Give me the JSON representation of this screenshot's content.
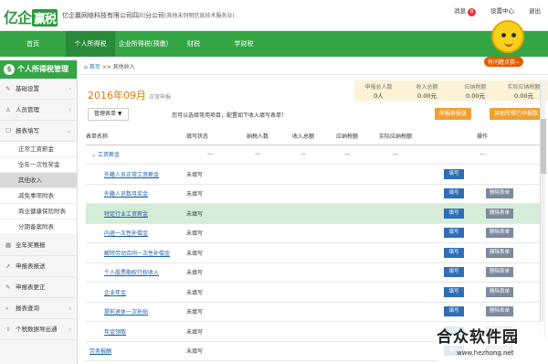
{
  "header": {
    "logo": "亿企",
    "logo_badge": "赢税",
    "company": "亿企赢网络科技有限公司四川分公司",
    "company_note": "(其他未列明信息技术服务业)",
    "message": "消息",
    "message_count": "8",
    "help": "设置中心",
    "link": "退出"
  },
  "nav": [
    "首页",
    "个人所得税",
    "企业所得税(预缴)",
    "财税",
    "学财税"
  ],
  "mascot_bubble": "有问题点我~",
  "sidebar": {
    "title": "个人所得税管理",
    "items": [
      "基础设置",
      "人员管理",
      "报表填写"
    ],
    "sub": [
      "正常工资薪金",
      "全年一次性奖金",
      "其他收入",
      "减免事项附表",
      "商业健康保险附表",
      "分期备案附表"
    ],
    "items2": [
      "全年奖赛报",
      "申报表报送",
      "申报表更正",
      "报表查询",
      "个税数据导出通"
    ]
  },
  "crumb": {
    "home": "首页",
    "sep": ">>",
    "current": "其他收入"
  },
  "period": {
    "text": "2016年09月",
    "note": "正常申报"
  },
  "stats": [
    {
      "k": "申报总人数",
      "v": "0人"
    },
    {
      "k": "收入总额",
      "v": "0.00元"
    },
    {
      "k": "应纳税额",
      "v": "0.00元"
    },
    {
      "k": "实际应纳税额",
      "v": "0.00元"
    }
  ],
  "toolbar": {
    "manage": "管理表单 ▼",
    "tip": "您可以选择常用项目，配置如下收入填写表单！",
    "btn1": "申报表报送",
    "btn2": "其他所得已申报数"
  },
  "table": {
    "headers": [
      "表单名称",
      "填写状态",
      "纳税人数",
      "收入总额",
      "应纳税额",
      "实际应纳税额",
      "操作"
    ],
    "group": "工资薪金",
    "rows": [
      {
        "name": "外籍人员正常工资薪金",
        "status": "未填写",
        "del": false,
        "hl": false
      },
      {
        "name": "外籍人员数月奖金",
        "status": "未填写",
        "del": true,
        "hl": false
      },
      {
        "name": "特定行业工资薪金",
        "status": "未填写",
        "del": true,
        "hl": true
      },
      {
        "name": "内退一次性补偿金",
        "status": "未填写",
        "del": true,
        "hl": false
      },
      {
        "name": "解除劳动合同一次性补偿金",
        "status": "未填写",
        "del": true,
        "hl": false
      },
      {
        "name": "个人股票期权行权收入",
        "status": "未填写",
        "del": true,
        "hl": false
      },
      {
        "name": "企业年金",
        "status": "未填写",
        "del": true,
        "hl": false
      },
      {
        "name": "提前退休一次补贴",
        "status": "未填写",
        "del": true,
        "hl": false
      },
      {
        "name": "年金领取",
        "status": "未填写",
        "del": true,
        "hl": false
      },
      {
        "name": "劳务报酬",
        "status": "未填写",
        "del": true,
        "hl": false,
        "top": true
      }
    ],
    "fill": "填写",
    "delete": "删除表单"
  },
  "watermark": {
    "big": "合众软件园",
    "small": "www.hezhong.net"
  }
}
